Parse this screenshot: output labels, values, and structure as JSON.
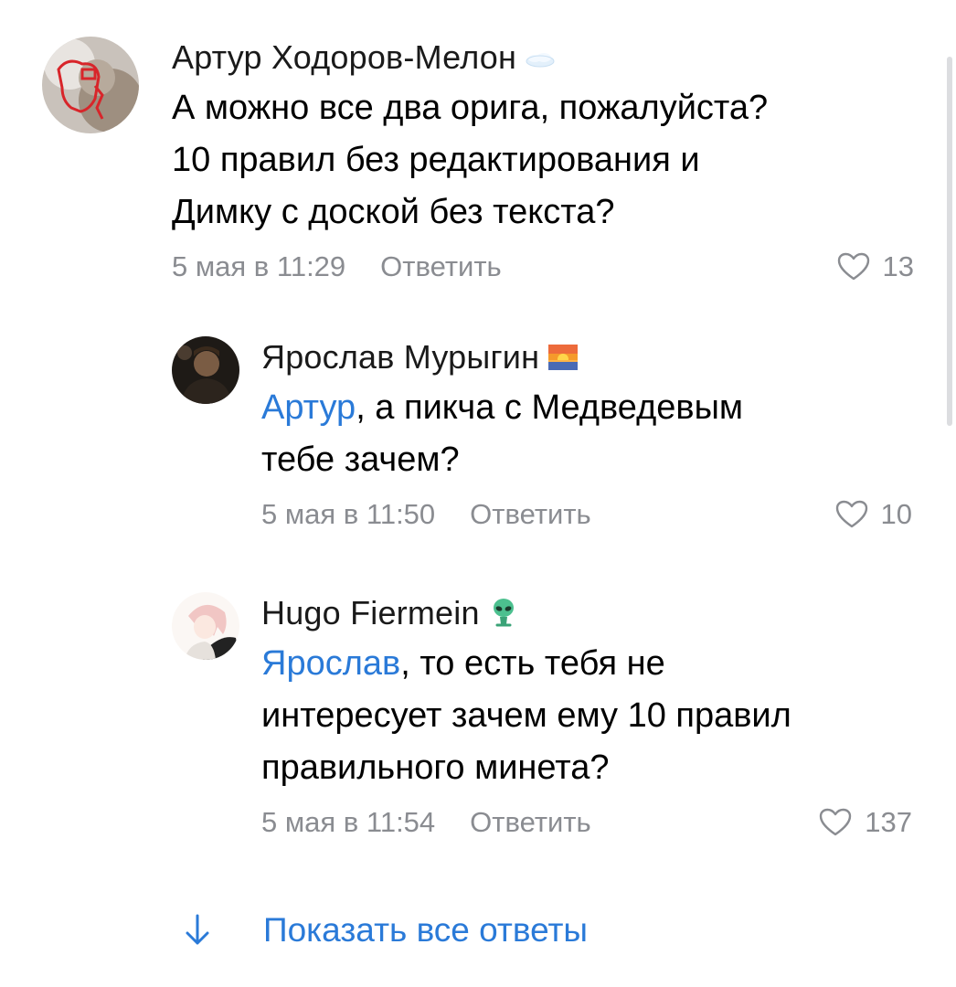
{
  "comments": [
    {
      "author": "Артур Ходоров-Мелон",
      "badge": "cloud-icon",
      "text_lines": [
        "А можно все два орига, пожалуйста?",
        "10 правил без редактирования и",
        "Димку с доской без текста?"
      ],
      "date": "5 мая в 11:29",
      "reply_label": "Ответить",
      "likes": "13"
    },
    {
      "author": "Ярослав Мурыгин",
      "badge": "sunset-icon",
      "mention": "Артур",
      "text_lines": [
        ", а пикча с Медведевым",
        "тебе зачем?"
      ],
      "date": "5 мая в 11:50",
      "reply_label": "Ответить",
      "likes": "10"
    },
    {
      "author": "Hugo Fiermein",
      "badge": "alien-icon",
      "mention": "Ярослав",
      "text_lines": [
        ", то есть тебя не",
        "интересует зачем ему 10 правил",
        "правильного минета?"
      ],
      "date": "5 мая в 11:54",
      "reply_label": "Ответить",
      "likes": "137"
    }
  ],
  "show_all_replies": "Показать все ответы",
  "colors": {
    "link": "#2a7ad8",
    "meta": "#8a8c91",
    "scrollbar": "#dcdde0"
  }
}
